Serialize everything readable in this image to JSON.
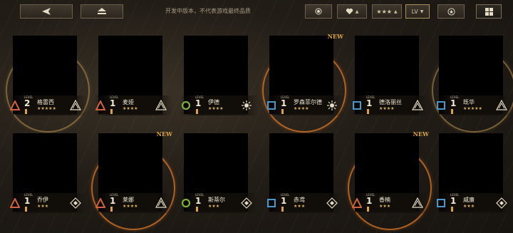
{
  "topbar": {
    "back_icon": "back-arrow-icon",
    "home_icon": "eject-icon",
    "notice": "开发中版本，不代表游戏最终品质",
    "filters": [
      {
        "name": "element-filter",
        "icon": "target-icon"
      },
      {
        "name": "favorite-filter",
        "icon": "heart-icon"
      },
      {
        "name": "rarity-filter",
        "text": "★★★"
      },
      {
        "name": "sort-level",
        "text": "LV"
      },
      {
        "name": "star-filter",
        "icon": "star-circle-icon"
      },
      {
        "name": "grid-view",
        "icon": "grid-icon"
      }
    ]
  },
  "colors": {
    "gold": "#d9a441",
    "orange": "#d9782a",
    "green": "#7cae3a",
    "blue": "#4b97c9",
    "red": "#d0613e"
  },
  "characters": [
    {
      "name": "格雷西",
      "level_label": "LEVEL",
      "level": "2",
      "stars": "★★★★★",
      "role": "triangle",
      "emblem": "tri-wing",
      "new": false,
      "ring": "gold"
    },
    {
      "name": "麦娅",
      "level_label": "LEVEL",
      "level": "1",
      "stars": "★★★★",
      "role": "triangle",
      "emblem": "tri-wing",
      "new": false,
      "ring": "none"
    },
    {
      "name": "伊德",
      "level_label": "LEVEL",
      "level": "1",
      "stars": "★★★★",
      "role": "circle",
      "emblem": "sun",
      "new": false,
      "ring": "none"
    },
    {
      "name": "罗森菲尔德",
      "level_label": "LEVEL",
      "level": "1",
      "stars": "★★★★",
      "role": "square",
      "emblem": "sun",
      "new": true,
      "new_label": "NEW",
      "ring": "orange"
    },
    {
      "name": "德洛丽丝",
      "level_label": "LEVEL",
      "level": "1",
      "stars": "★★★★",
      "role": "square",
      "emblem": "tri-wing",
      "new": false,
      "ring": "none"
    },
    {
      "name": "既华",
      "level_label": "LEVEL",
      "level": "1",
      "stars": "★★★★★",
      "role": "square",
      "emblem": "tri-wing",
      "new": false,
      "ring": "gold"
    },
    {
      "name": "乔伊",
      "level_label": "LEVEL",
      "level": "1",
      "stars": "★★★",
      "role": "triangle",
      "emblem": "diamond",
      "new": false,
      "ring": "none"
    },
    {
      "name": "莱娜",
      "level_label": "LEVEL",
      "level": "1",
      "stars": "★★★★",
      "role": "triangle",
      "emblem": "tri-wing",
      "new": true,
      "new_label": "NEW",
      "ring": "orange"
    },
    {
      "name": "斯蒂尔",
      "level_label": "LEVEL",
      "level": "1",
      "stars": "★★★",
      "role": "circle",
      "emblem": "diamond",
      "new": false,
      "ring": "none"
    },
    {
      "name": "赤鸢",
      "level_label": "LEVEL",
      "level": "1",
      "stars": "★★★",
      "role": "square",
      "emblem": "diamond",
      "new": false,
      "ring": "none"
    },
    {
      "name": "香楠",
      "level_label": "LEVEL",
      "level": "1",
      "stars": "★★★",
      "role": "triangle",
      "emblem": "tri-wing",
      "new": true,
      "new_label": "NEW",
      "ring": "orange"
    },
    {
      "name": "威廉",
      "level_label": "LEVEL",
      "level": "1",
      "stars": "★★★",
      "role": "square",
      "emblem": "diamond",
      "new": false,
      "ring": "none"
    }
  ]
}
